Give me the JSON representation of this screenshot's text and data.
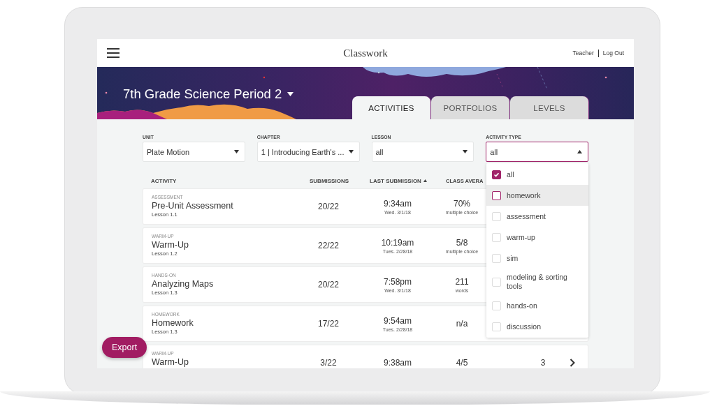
{
  "header": {
    "title": "Classwork",
    "user": "Teacher",
    "logout": "Log Out"
  },
  "banner": {
    "title": "7th Grade Science Period 2"
  },
  "tabs": [
    {
      "label": "ACTIVITIES",
      "selected": true
    },
    {
      "label": "PORTFOLIOS",
      "selected": false
    },
    {
      "label": "LEVELS",
      "selected": false
    }
  ],
  "filters": [
    {
      "label": "UNIT",
      "value": "Plate Motion",
      "expanded": false
    },
    {
      "label": "CHAPTER",
      "value": "1 | Introducing Earth's ...",
      "expanded": false
    },
    {
      "label": "LESSON",
      "value": "all",
      "expanded": false
    },
    {
      "label": "ACTIVITY TYPE",
      "value": "all",
      "expanded": true
    }
  ],
  "table": {
    "columns": [
      "ACTIVITY",
      "SUBMISSIONS",
      "LAST SUBMISSION",
      "CLASS AVERA"
    ],
    "rows": [
      {
        "category": "ASSESSMENT",
        "title": "Pre-Unit Assessment",
        "lesson": "Lesson 1.1",
        "submissions": "20/22",
        "last_time": "9:34am",
        "last_date": "Wed. 3/1/18",
        "average": "70%",
        "average_note": "multiple choice"
      },
      {
        "category": "WARM-UP",
        "title": "Warm-Up",
        "lesson": "Lesson 1.2",
        "submissions": "22/22",
        "last_time": "10:19am",
        "last_date": "Tues. 2/28/18",
        "average": "5/8",
        "average_note": "multiple choice"
      },
      {
        "category": "HANDS-ON",
        "title": "Analyzing Maps",
        "lesson": "Lesson 1.3",
        "submissions": "20/22",
        "last_time": "7:58pm",
        "last_date": "Wed. 3/1/18",
        "average": "211",
        "average_note": "words"
      },
      {
        "category": "HOMEWORK",
        "title": "Homework",
        "lesson": "Lesson 1.3",
        "submissions": "17/22",
        "last_time": "9:54am",
        "last_date": "Tues. 2/28/18",
        "average": "n/a"
      },
      {
        "category": "WARM-UP",
        "title": "Warm-Up",
        "submissions": "3/22",
        "last_time": "9:38am",
        "average": "4/5",
        "column_5": "3"
      }
    ]
  },
  "dropdown": [
    {
      "label": "all",
      "checked": true,
      "highlighted": false
    },
    {
      "label": "homework",
      "checked": false,
      "highlighted": true
    },
    {
      "label": "assessment",
      "checked": false,
      "highlighted": false
    },
    {
      "label": "warm-up",
      "checked": false,
      "highlighted": false
    },
    {
      "label": "sim",
      "checked": false,
      "highlighted": false
    },
    {
      "label": "modeling & sorting tools",
      "checked": false,
      "highlighted": false
    },
    {
      "label": "hands-on",
      "checked": false,
      "highlighted": false
    },
    {
      "label": "discussion",
      "checked": false,
      "highlighted": false
    }
  ],
  "export_button": "Export"
}
